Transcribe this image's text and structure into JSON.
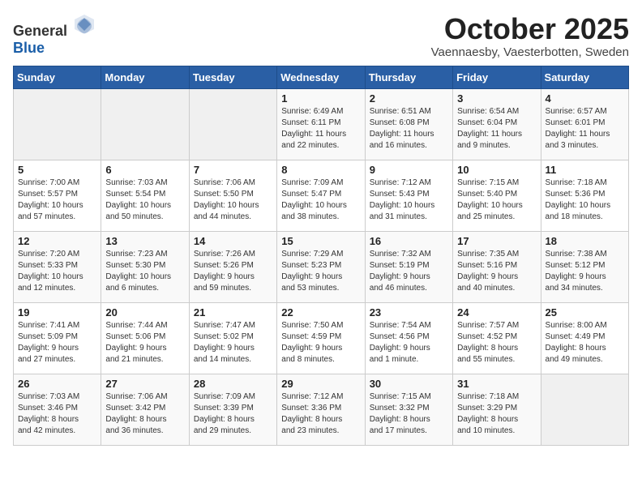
{
  "header": {
    "logo_general": "General",
    "logo_blue": "Blue",
    "title": "October 2025",
    "subtitle": "Vaennaesby, Vaesterbotten, Sweden"
  },
  "weekdays": [
    "Sunday",
    "Monday",
    "Tuesday",
    "Wednesday",
    "Thursday",
    "Friday",
    "Saturday"
  ],
  "weeks": [
    [
      {
        "day": "",
        "info": ""
      },
      {
        "day": "",
        "info": ""
      },
      {
        "day": "",
        "info": ""
      },
      {
        "day": "1",
        "info": "Sunrise: 6:49 AM\nSunset: 6:11 PM\nDaylight: 11 hours\nand 22 minutes."
      },
      {
        "day": "2",
        "info": "Sunrise: 6:51 AM\nSunset: 6:08 PM\nDaylight: 11 hours\nand 16 minutes."
      },
      {
        "day": "3",
        "info": "Sunrise: 6:54 AM\nSunset: 6:04 PM\nDaylight: 11 hours\nand 9 minutes."
      },
      {
        "day": "4",
        "info": "Sunrise: 6:57 AM\nSunset: 6:01 PM\nDaylight: 11 hours\nand 3 minutes."
      }
    ],
    [
      {
        "day": "5",
        "info": "Sunrise: 7:00 AM\nSunset: 5:57 PM\nDaylight: 10 hours\nand 57 minutes."
      },
      {
        "day": "6",
        "info": "Sunrise: 7:03 AM\nSunset: 5:54 PM\nDaylight: 10 hours\nand 50 minutes."
      },
      {
        "day": "7",
        "info": "Sunrise: 7:06 AM\nSunset: 5:50 PM\nDaylight: 10 hours\nand 44 minutes."
      },
      {
        "day": "8",
        "info": "Sunrise: 7:09 AM\nSunset: 5:47 PM\nDaylight: 10 hours\nand 38 minutes."
      },
      {
        "day": "9",
        "info": "Sunrise: 7:12 AM\nSunset: 5:43 PM\nDaylight: 10 hours\nand 31 minutes."
      },
      {
        "day": "10",
        "info": "Sunrise: 7:15 AM\nSunset: 5:40 PM\nDaylight: 10 hours\nand 25 minutes."
      },
      {
        "day": "11",
        "info": "Sunrise: 7:18 AM\nSunset: 5:36 PM\nDaylight: 10 hours\nand 18 minutes."
      }
    ],
    [
      {
        "day": "12",
        "info": "Sunrise: 7:20 AM\nSunset: 5:33 PM\nDaylight: 10 hours\nand 12 minutes."
      },
      {
        "day": "13",
        "info": "Sunrise: 7:23 AM\nSunset: 5:30 PM\nDaylight: 10 hours\nand 6 minutes."
      },
      {
        "day": "14",
        "info": "Sunrise: 7:26 AM\nSunset: 5:26 PM\nDaylight: 9 hours\nand 59 minutes."
      },
      {
        "day": "15",
        "info": "Sunrise: 7:29 AM\nSunset: 5:23 PM\nDaylight: 9 hours\nand 53 minutes."
      },
      {
        "day": "16",
        "info": "Sunrise: 7:32 AM\nSunset: 5:19 PM\nDaylight: 9 hours\nand 46 minutes."
      },
      {
        "day": "17",
        "info": "Sunrise: 7:35 AM\nSunset: 5:16 PM\nDaylight: 9 hours\nand 40 minutes."
      },
      {
        "day": "18",
        "info": "Sunrise: 7:38 AM\nSunset: 5:12 PM\nDaylight: 9 hours\nand 34 minutes."
      }
    ],
    [
      {
        "day": "19",
        "info": "Sunrise: 7:41 AM\nSunset: 5:09 PM\nDaylight: 9 hours\nand 27 minutes."
      },
      {
        "day": "20",
        "info": "Sunrise: 7:44 AM\nSunset: 5:06 PM\nDaylight: 9 hours\nand 21 minutes."
      },
      {
        "day": "21",
        "info": "Sunrise: 7:47 AM\nSunset: 5:02 PM\nDaylight: 9 hours\nand 14 minutes."
      },
      {
        "day": "22",
        "info": "Sunrise: 7:50 AM\nSunset: 4:59 PM\nDaylight: 9 hours\nand 8 minutes."
      },
      {
        "day": "23",
        "info": "Sunrise: 7:54 AM\nSunset: 4:56 PM\nDaylight: 9 hours\nand 1 minute."
      },
      {
        "day": "24",
        "info": "Sunrise: 7:57 AM\nSunset: 4:52 PM\nDaylight: 8 hours\nand 55 minutes."
      },
      {
        "day": "25",
        "info": "Sunrise: 8:00 AM\nSunset: 4:49 PM\nDaylight: 8 hours\nand 49 minutes."
      }
    ],
    [
      {
        "day": "26",
        "info": "Sunrise: 7:03 AM\nSunset: 3:46 PM\nDaylight: 8 hours\nand 42 minutes."
      },
      {
        "day": "27",
        "info": "Sunrise: 7:06 AM\nSunset: 3:42 PM\nDaylight: 8 hours\nand 36 minutes."
      },
      {
        "day": "28",
        "info": "Sunrise: 7:09 AM\nSunset: 3:39 PM\nDaylight: 8 hours\nand 29 minutes."
      },
      {
        "day": "29",
        "info": "Sunrise: 7:12 AM\nSunset: 3:36 PM\nDaylight: 8 hours\nand 23 minutes."
      },
      {
        "day": "30",
        "info": "Sunrise: 7:15 AM\nSunset: 3:32 PM\nDaylight: 8 hours\nand 17 minutes."
      },
      {
        "day": "31",
        "info": "Sunrise: 7:18 AM\nSunset: 3:29 PM\nDaylight: 8 hours\nand 10 minutes."
      },
      {
        "day": "",
        "info": ""
      }
    ]
  ]
}
